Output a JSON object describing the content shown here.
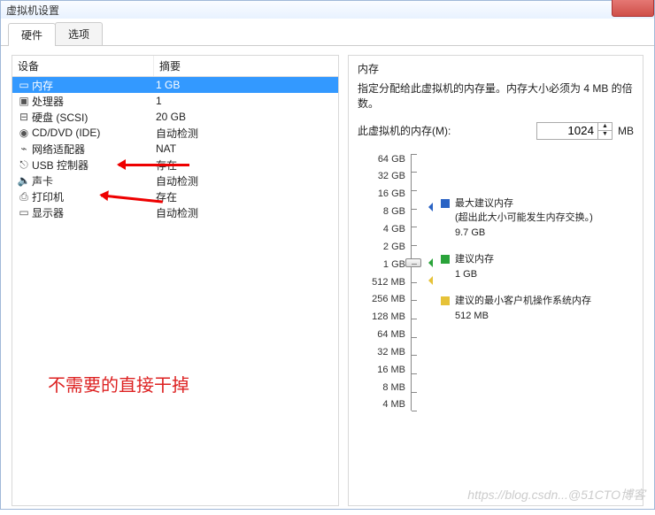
{
  "window": {
    "title": "虚拟机设置"
  },
  "tabs": {
    "hardware": "硬件",
    "options": "选项"
  },
  "table": {
    "col_device": "设备",
    "col_summary": "摘要",
    "rows": [
      {
        "icon": "memory-icon",
        "glyph": "▭",
        "name": "内存",
        "summary": "1 GB",
        "selected": true
      },
      {
        "icon": "cpu-icon",
        "glyph": "▣",
        "name": "处理器",
        "summary": "1"
      },
      {
        "icon": "disk-icon",
        "glyph": "⊟",
        "name": "硬盘 (SCSI)",
        "summary": "20 GB"
      },
      {
        "icon": "cd-icon",
        "glyph": "◉",
        "name": "CD/DVD (IDE)",
        "summary": "自动检测"
      },
      {
        "icon": "nic-icon",
        "glyph": "⌁",
        "name": "网络适配器",
        "summary": "NAT"
      },
      {
        "icon": "usb-icon",
        "glyph": "⎋",
        "name": "USB 控制器",
        "summary": "存在"
      },
      {
        "icon": "sound-icon",
        "glyph": "🔈",
        "name": "声卡",
        "summary": "自动检测"
      },
      {
        "icon": "printer-icon",
        "glyph": "⎙",
        "name": "打印机",
        "summary": "存在"
      },
      {
        "icon": "display-icon",
        "glyph": "▭",
        "name": "显示器",
        "summary": "自动检测"
      }
    ]
  },
  "annotation": "不需要的直接干掉",
  "memory": {
    "title": "内存",
    "desc": "指定分配给此虚拟机的内存量。内存大小必须为 4 MB 的倍数。",
    "label": "此虚拟机的内存(M):",
    "value": "1024",
    "unit": "MB",
    "ticks": [
      "64 GB",
      "32 GB",
      "16 GB",
      "8 GB",
      "4 GB",
      "2 GB",
      "1 GB",
      "512 MB",
      "256 MB",
      "128 MB",
      "64 MB",
      "32 MB",
      "16 MB",
      "8 MB",
      "4 MB"
    ],
    "legend": {
      "max": {
        "title": "最大建议内存",
        "note": "(超出此大小可能发生内存交换。)",
        "value": "9.7 GB",
        "color": "#2a63c4"
      },
      "rec": {
        "title": "建议内存",
        "value": "1 GB",
        "color": "#2aa33a"
      },
      "min": {
        "title": "建议的最小客户机操作系统内存",
        "value": "512 MB",
        "color": "#e6c238"
      }
    }
  },
  "watermark": "https://blog.csdn...@51CTO博客"
}
